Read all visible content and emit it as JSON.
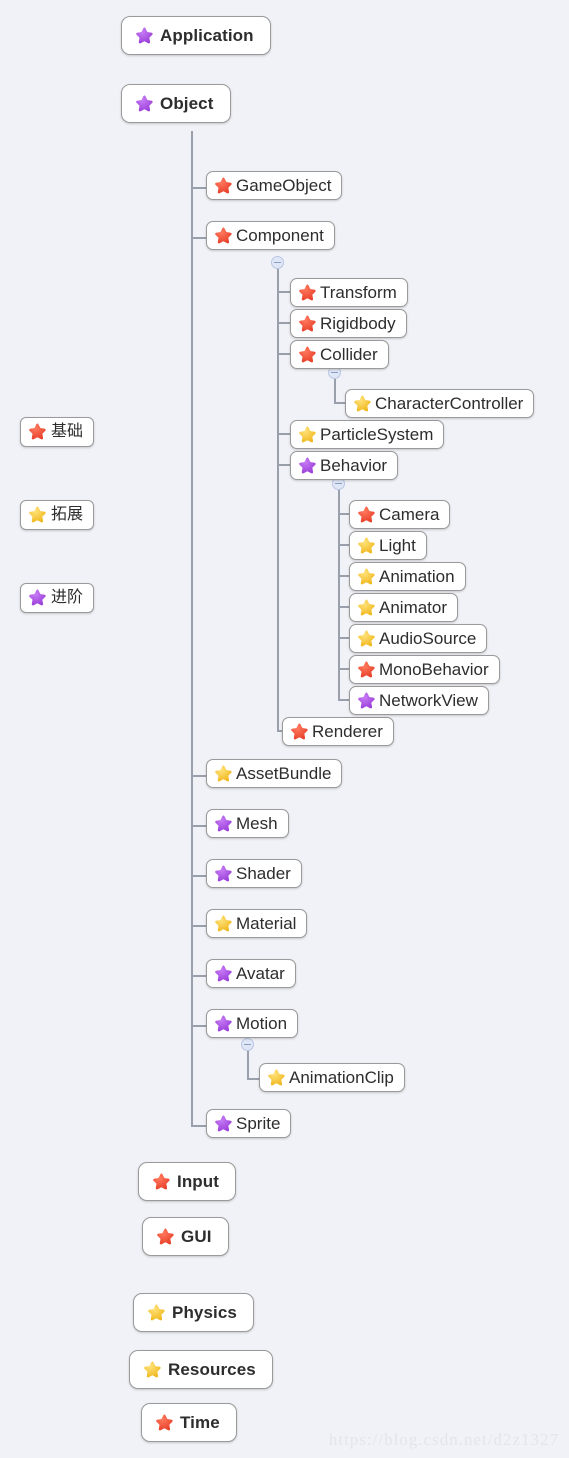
{
  "canvas": {
    "background": "#f0f2f7",
    "connector_color": "#9aa0ab"
  },
  "colors": {
    "basic_red": "#e8402a",
    "extension_yellow": "#f5c433",
    "advanced_purple": "#a64ce0",
    "node_background": "#ffffff",
    "node_border": "#9a9a9a",
    "text": "#2d2d2d"
  },
  "legend": {
    "title": "legend",
    "items": [
      {
        "label": "基础",
        "icon": "star-icon",
        "color": "basic_red"
      },
      {
        "label": "拓展",
        "icon": "star-icon",
        "color": "extension_yellow"
      },
      {
        "label": "进阶",
        "icon": "star-icon",
        "color": "advanced_purple"
      }
    ]
  },
  "tree": {
    "roots": [
      {
        "label": "Application",
        "color": "advanced_purple"
      },
      {
        "label": "Object",
        "color": "advanced_purple"
      },
      {
        "label": "Input",
        "color": "basic_red"
      },
      {
        "label": "GUI",
        "color": "basic_red"
      },
      {
        "label": "Physics",
        "color": "extension_yellow"
      },
      {
        "label": "Resources",
        "color": "extension_yellow"
      },
      {
        "label": "Time",
        "color": "basic_red"
      }
    ],
    "object_children": [
      {
        "label": "GameObject",
        "color": "basic_red"
      },
      {
        "label": "Component",
        "color": "basic_red"
      },
      {
        "label": "AssetBundle",
        "color": "extension_yellow"
      },
      {
        "label": "Mesh",
        "color": "advanced_purple"
      },
      {
        "label": "Shader",
        "color": "advanced_purple"
      },
      {
        "label": "Material",
        "color": "extension_yellow"
      },
      {
        "label": "Avatar",
        "color": "advanced_purple"
      },
      {
        "label": "Motion",
        "color": "advanced_purple"
      },
      {
        "label": "Sprite",
        "color": "advanced_purple"
      }
    ],
    "component_children": [
      {
        "label": "Transform",
        "color": "basic_red"
      },
      {
        "label": "Rigidbody",
        "color": "basic_red"
      },
      {
        "label": "Collider",
        "color": "basic_red"
      },
      {
        "label": "ParticleSystem",
        "color": "extension_yellow"
      },
      {
        "label": "Behavior",
        "color": "advanced_purple"
      },
      {
        "label": "Renderer",
        "color": "basic_red"
      }
    ],
    "collider_children": [
      {
        "label": "CharacterController",
        "color": "extension_yellow"
      }
    ],
    "behavior_children": [
      {
        "label": "Camera",
        "color": "basic_red"
      },
      {
        "label": "Light",
        "color": "extension_yellow"
      },
      {
        "label": "Animation",
        "color": "extension_yellow"
      },
      {
        "label": "Animator",
        "color": "extension_yellow"
      },
      {
        "label": "AudioSource",
        "color": "extension_yellow"
      },
      {
        "label": "MonoBehavior",
        "color": "basic_red"
      },
      {
        "label": "NetworkView",
        "color": "advanced_purple"
      }
    ],
    "motion_children": [
      {
        "label": "AnimationClip",
        "color": "extension_yellow"
      }
    ]
  },
  "toggles": {
    "state": "expanded",
    "symbol": "minus"
  },
  "watermark": {
    "text": "https://blog.csdn.net/d2z1327"
  }
}
